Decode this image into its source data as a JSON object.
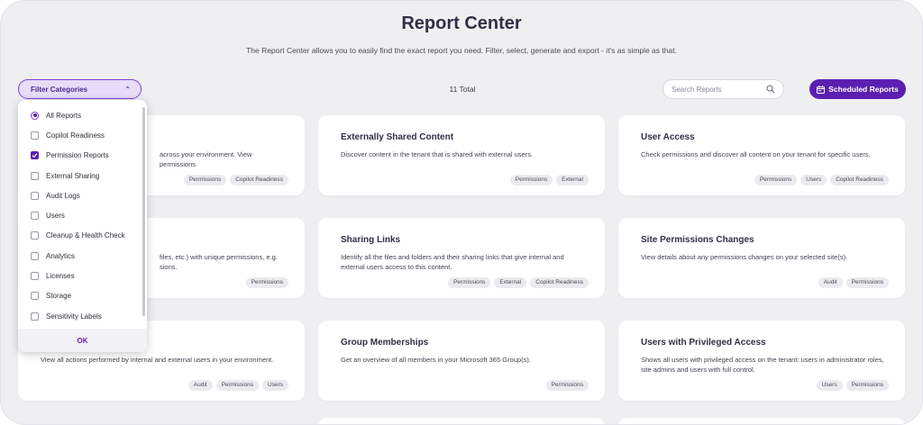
{
  "header": {
    "title": "Report Center",
    "subtitle": "The Report Center allows you to easily find the exact report you need. Filter, select, generate and export - it's as simple as that."
  },
  "toolbar": {
    "filter_label": "Filter Categories",
    "filter_icon": "chevron-up-icon",
    "total_label": "11 Total",
    "search_placeholder": "Search Reports",
    "scheduled_label": "Scheduled Reports"
  },
  "colors": {
    "accent": "#5b1fb0",
    "filter_bg": "#e7dcfa",
    "page_bg": "#efeff2"
  },
  "filter_dropdown": {
    "items": [
      {
        "label": "All Reports",
        "type": "radio",
        "checked": true
      },
      {
        "label": "Copilot Readiness",
        "type": "checkbox",
        "checked": false
      },
      {
        "label": "Permission Reports",
        "type": "checkbox",
        "checked": true
      },
      {
        "label": "External Sharing",
        "type": "checkbox",
        "checked": false
      },
      {
        "label": "Audit Logs",
        "type": "checkbox",
        "checked": false
      },
      {
        "label": "Users",
        "type": "checkbox",
        "checked": false
      },
      {
        "label": "Cleanup & Health Check",
        "type": "checkbox",
        "checked": false
      },
      {
        "label": "Analytics",
        "type": "checkbox",
        "checked": false
      },
      {
        "label": "Licenses",
        "type": "checkbox",
        "checked": false
      },
      {
        "label": "Storage",
        "type": "checkbox",
        "checked": false
      },
      {
        "label": "Sensitivity Labels",
        "type": "checkbox",
        "checked": false
      }
    ],
    "ok_label": "OK"
  },
  "cards": [
    {
      "title": "",
      "desc": "across your environment. View permissions",
      "tags": [
        "Permissions",
        "Copilot Readiness"
      ]
    },
    {
      "title": "Externally Shared Content",
      "desc": "Discover content in the tenant that is shared with external users.",
      "tags": [
        "Permissions",
        "External"
      ]
    },
    {
      "title": "User Access",
      "desc": "Check permissions and discover all content on your tenant for specific users.",
      "tags": [
        "Permissions",
        "Users",
        "Copilot Readiness"
      ]
    },
    {
      "title": "",
      "desc": "files, etc.) with unique permissions, e.g. sions.",
      "tags": [
        "Permissions"
      ]
    },
    {
      "title": "Sharing Links",
      "desc": "Identify all the files and folders and their sharing links that give internal and external users access to this content.",
      "tags": [
        "Permissions",
        "External",
        "Copilot Readiness"
      ]
    },
    {
      "title": "Site Permissions Changes",
      "desc": "View details about any permissions changes on your selected site(s).",
      "tags": [
        "Audit",
        "Permissions"
      ]
    },
    {
      "title": "",
      "desc": "View all actions performed by internal and external users in your environment.",
      "tags": [
        "Audit",
        "Permissions",
        "Users"
      ]
    },
    {
      "title": "Group Memberships",
      "desc": "Get an overview of all members in your Microsoft 365 Group(s).",
      "tags": [
        "Permissions"
      ]
    },
    {
      "title": "Users with Privileged Access",
      "desc": "Shows all users with privileged access on the tenant: users in administrator roles, site admins and users with full control.",
      "tags": [
        "Users",
        "Permissions"
      ]
    }
  ]
}
